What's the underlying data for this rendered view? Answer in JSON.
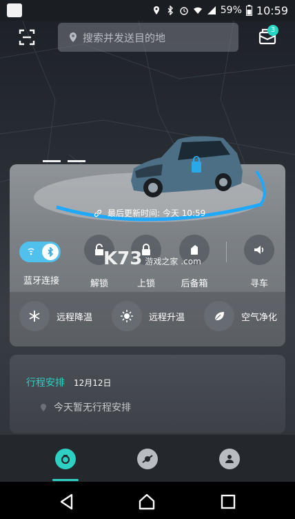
{
  "status_bar": {
    "battery": "59%",
    "time": "10:59",
    "icons": [
      "location-icon",
      "bluetooth-icon",
      "alarm-icon",
      "wifi-icon",
      "signal-icon",
      "battery-icon"
    ]
  },
  "top_bar": {
    "search_placeholder": "搜索并发送目的地",
    "message_badge": "3",
    "icons": [
      "scan-icon",
      "location-pin-icon",
      "message-icon"
    ]
  },
  "car_card": {
    "last_update": "最后更新时间: 今天 10:59",
    "bluetooth_label": "蓝牙连接",
    "bluetooth_on": true,
    "controls": [
      {
        "label": "解锁",
        "icon": "unlock-icon"
      },
      {
        "label": "上锁",
        "icon": "lock-icon"
      },
      {
        "label": "后备箱",
        "icon": "trunk-icon"
      },
      {
        "label": "寻车",
        "icon": "speaker-icon"
      }
    ],
    "climate": [
      {
        "label": "远程降温",
        "icon": "snowflake-icon"
      },
      {
        "label": "远程升温",
        "icon": "sun-icon"
      },
      {
        "label": "空气净化",
        "icon": "leaf-icon"
      }
    ]
  },
  "trip": {
    "title": "行程安排",
    "date": "12月12日",
    "empty_text": "今天暂无行程安排"
  },
  "watermark": {
    "brand": "K73",
    "sub": "游戏之家",
    "domain": ".com"
  },
  "tabs": [
    {
      "icon": "drive-icon",
      "active": true
    },
    {
      "icon": "discover-icon",
      "active": false
    },
    {
      "icon": "profile-icon",
      "active": false
    }
  ],
  "colors": {
    "accent": "#2ed0c4",
    "bluetooth_toggle": "#4fc1ec",
    "ring_glow": "#1fa8ff"
  }
}
